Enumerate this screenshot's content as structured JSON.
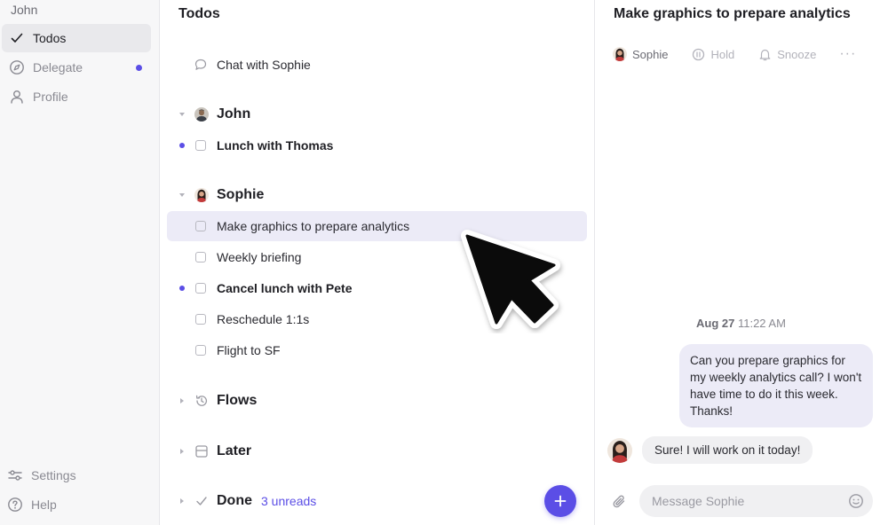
{
  "sidebar": {
    "user": "John",
    "items": [
      {
        "label": "Todos",
        "icon": "check-icon"
      },
      {
        "label": "Delegate",
        "icon": "compass-icon"
      },
      {
        "label": "Profile",
        "icon": "person-icon"
      }
    ],
    "bottom": [
      {
        "label": "Settings",
        "icon": "sliders-icon"
      },
      {
        "label": "Help",
        "icon": "help-icon"
      }
    ]
  },
  "todos": {
    "title": "Todos",
    "chat_item": "Chat with Sophie",
    "groups": {
      "john": {
        "name": "John",
        "items": [
          "Lunch with Thomas"
        ]
      },
      "sophie": {
        "name": "Sophie",
        "items": [
          "Make graphics to prepare analytics",
          "Weekly briefing",
          "Cancel lunch with Pete",
          "Reschedule 1:1s",
          "Flight to SF"
        ]
      },
      "flows": {
        "name": "Flows"
      },
      "later": {
        "name": "Later"
      },
      "done": {
        "name": "Done",
        "badge": "3 unreads"
      }
    },
    "add_button": "+"
  },
  "detail": {
    "title": "Make graphics to prepare analytics",
    "actions": {
      "assignee": "Sophie",
      "hold": "Hold",
      "snooze": "Snooze",
      "more": "···"
    },
    "timestamp_date": "Aug 27",
    "timestamp_time": "11:22 AM",
    "outgoing_message": "Can you prepare graphics for my weekly analytics call? I won't have time to do it this week. Thanks!",
    "incoming_message": "Sure! I will work on it today!",
    "composer_placeholder": "Message Sophie"
  },
  "colors": {
    "accent": "#5b4ee6",
    "selected_row": "#ecebf7",
    "sidebar_bg": "#f7f7f8"
  }
}
